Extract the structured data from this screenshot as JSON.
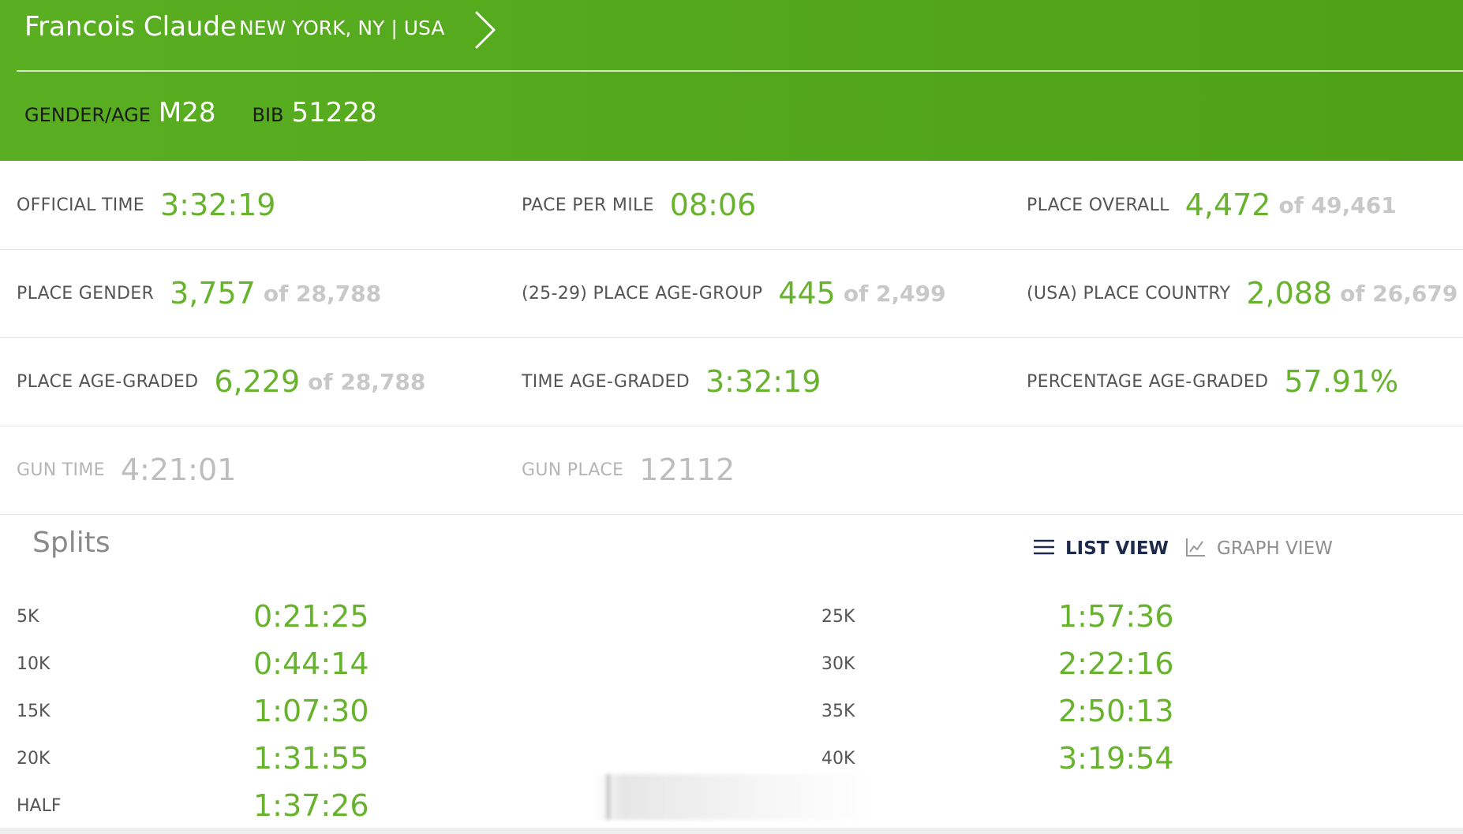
{
  "runner": {
    "name": "Francois Claude",
    "location": "NEW YORK, NY | USA",
    "gender_age_label": "GENDER/AGE",
    "gender_age": "M28",
    "bib_label": "BIB",
    "bib": "51228"
  },
  "stats": {
    "official_time": {
      "label": "OFFICIAL TIME",
      "value": "3:32:19"
    },
    "pace_per_mile": {
      "label": "PACE PER MILE",
      "value": "08:06"
    },
    "place_overall": {
      "label": "PLACE OVERALL",
      "value": "4,472",
      "of": "of 49,461"
    },
    "place_gender": {
      "label": "PLACE GENDER",
      "value": "3,757",
      "of": "of 28,788"
    },
    "place_age_group": {
      "label": "(25-29) PLACE AGE-GROUP",
      "value": "445",
      "of": "of 2,499"
    },
    "place_country": {
      "label": "(USA) PLACE COUNTRY",
      "value": "2,088",
      "of": "of 26,679"
    },
    "place_age_graded": {
      "label": "PLACE AGE-GRADED",
      "value": "6,229",
      "of": "of 28,788"
    },
    "time_age_graded": {
      "label": "TIME AGE-GRADED",
      "value": "3:32:19"
    },
    "percentage_age_graded": {
      "label": "PERCENTAGE AGE-GRADED",
      "value": "57.91%"
    },
    "gun_time": {
      "label": "GUN TIME",
      "value": "4:21:01"
    },
    "gun_place": {
      "label": "GUN PLACE",
      "value": "12112"
    }
  },
  "splits": {
    "title": "Splits",
    "list_view_label": "LIST VIEW",
    "graph_view_label": "GRAPH VIEW",
    "left": [
      {
        "distance": "5K",
        "time": "0:21:25"
      },
      {
        "distance": "10K",
        "time": "0:44:14"
      },
      {
        "distance": "15K",
        "time": "1:07:30"
      },
      {
        "distance": "20K",
        "time": "1:31:55"
      },
      {
        "distance": "HALF",
        "time": "1:37:26"
      }
    ],
    "right": [
      {
        "distance": "25K",
        "time": "1:57:36"
      },
      {
        "distance": "30K",
        "time": "2:22:16"
      },
      {
        "distance": "35K",
        "time": "2:50:13"
      },
      {
        "distance": "40K",
        "time": "3:19:54"
      }
    ]
  },
  "colors": {
    "header_green": "#5aae22",
    "value_green": "#67b32e",
    "muted_gray": "#c8c8c8",
    "active_view_navy": "#1e2a4a"
  },
  "icons": {
    "next": "chevron-right-icon",
    "list_view": "list-icon",
    "graph_view": "line-chart-icon"
  }
}
